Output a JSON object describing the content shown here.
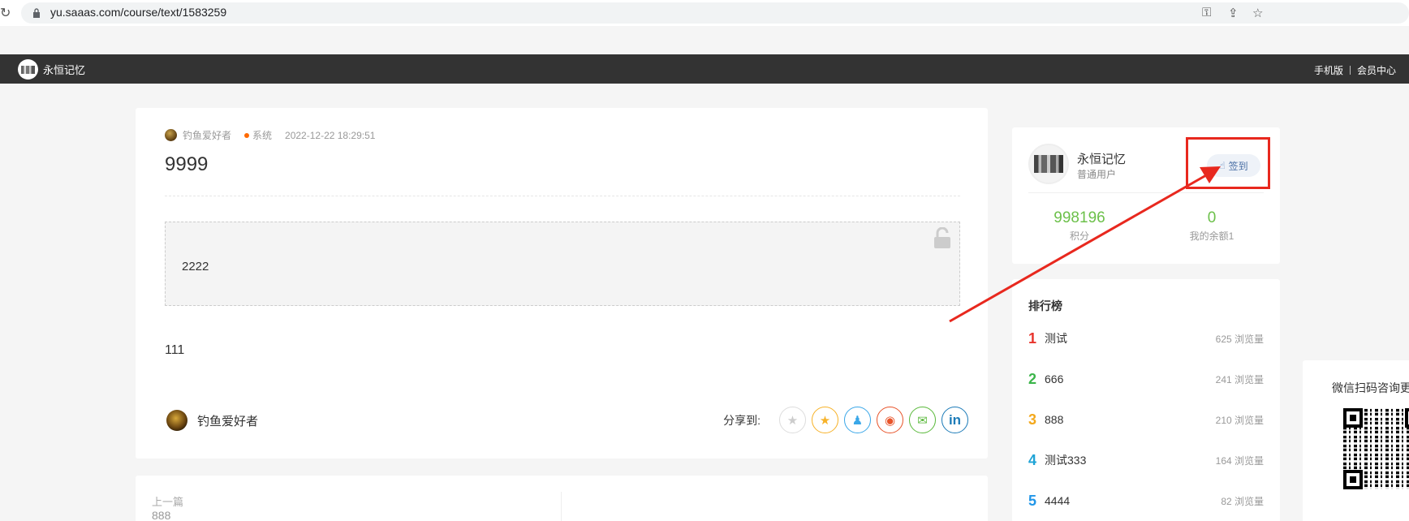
{
  "browser": {
    "url": "yu.saaas.com/course/text/1583259",
    "reload_icon": "reload-icon",
    "key_icon": "key-icon",
    "share_icon": "share-icon",
    "star_icon": "star-icon"
  },
  "nav": {
    "brand": "永恒记忆",
    "links": [
      "手机版",
      "会员中心"
    ]
  },
  "article": {
    "author": "钓鱼爱好者",
    "category": "系统",
    "time": "2022-12-22 18:29:51",
    "title": "9999",
    "locked_content": "2222",
    "body": "111",
    "footer_author": "钓鱼爱好者",
    "share_label": "分享到:",
    "share_targets": [
      {
        "name": "favorite",
        "glyph": "★",
        "color": "#cccccc"
      },
      {
        "name": "qzone",
        "glyph": "★",
        "color": "#f7b228"
      },
      {
        "name": "qq",
        "glyph": "♟",
        "color": "#3aa7e8"
      },
      {
        "name": "weibo",
        "glyph": "◉",
        "color": "#e8542a"
      },
      {
        "name": "wechat",
        "glyph": "✉",
        "color": "#5ab93b"
      },
      {
        "name": "linkedin",
        "glyph": "in",
        "color": "#1c7bb8"
      }
    ]
  },
  "prev": {
    "label": "上一篇",
    "title": "888"
  },
  "user": {
    "name": "永恒记忆",
    "role": "普通用户",
    "signin": "签到",
    "points_value": "998196",
    "points_label": "积分",
    "balance_value": "0",
    "balance_label": "我的余额1"
  },
  "ranking": {
    "title": "排行榜",
    "items": [
      {
        "rank": "1",
        "name": "测试",
        "views": "625 浏览量",
        "color": "#e8342c"
      },
      {
        "rank": "2",
        "name": "666",
        "views": "241 浏览量",
        "color": "#3bb54a"
      },
      {
        "rank": "3",
        "name": "888",
        "views": "210 浏览量",
        "color": "#f3a81c"
      },
      {
        "rank": "4",
        "name": "测试333",
        "views": "164 浏览量",
        "color": "#1fa3d6"
      },
      {
        "rank": "5",
        "name": "4444",
        "views": "82 浏览量",
        "color": "#2196e8"
      }
    ]
  },
  "qr": {
    "title": "微信扫码咨询更"
  }
}
